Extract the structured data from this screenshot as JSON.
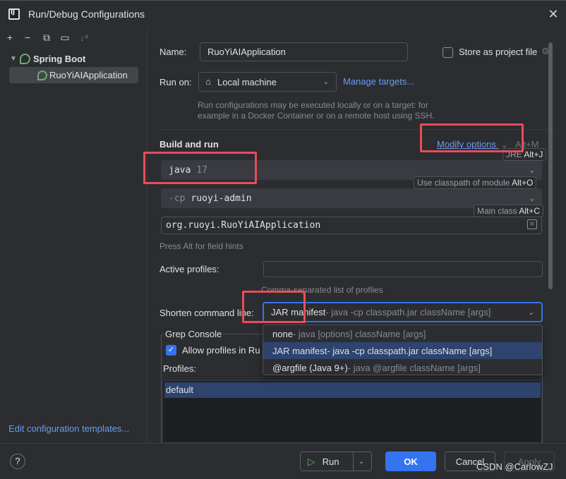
{
  "window": {
    "title": "Run/Debug Configurations"
  },
  "toolbar": {
    "add": "+",
    "remove": "−",
    "copy": "⧉",
    "folder": "▭",
    "sort": "↓ᵃ"
  },
  "tree": {
    "group_label": "Spring Boot",
    "items": [
      {
        "label": "RuoYiAIApplication"
      }
    ]
  },
  "edit_templates_link": "Edit configuration templates...",
  "form": {
    "name_label": "Name:",
    "name_value": "RuoYiAIApplication",
    "store_label": "Store as project file",
    "run_on_label": "Run on:",
    "run_on_value": "Local machine",
    "manage_targets": "Manage targets...",
    "run_on_hint_1": "Run configurations may be executed locally or on a target: for",
    "run_on_hint_2": "example in a Docker Container or on a remote host using SSH.",
    "section_build": "Build and run",
    "modify_options": "Modify options",
    "modify_shortcut": "Alt+M",
    "jre_value": "java",
    "jre_version": "17",
    "cp_prefix": "-cp",
    "cp_value": "ruoyi-admin",
    "main_class": "org.ruoyi.RuoYiAIApplication",
    "field_hint": "Press Alt for field hints",
    "active_profiles_label": "Active profiles:",
    "active_profiles_value": "",
    "active_profiles_hint": "Comma-separated list of profiles",
    "shorten_label": "Shorten command line:",
    "shorten_value": "JAR manifest",
    "shorten_value_detail": " - java -cp classpath.jar className [args]",
    "grep_console": "Grep Console",
    "allow_profiles": "Allow profiles in Ru",
    "profiles_label": "Profiles:",
    "profiles": [
      "default"
    ]
  },
  "tips": {
    "jre": {
      "text": "JRE ",
      "key": "Alt+J"
    },
    "classpath": {
      "text": "Use classpath of module ",
      "key": "Alt+O"
    },
    "main_class": {
      "text": "Main class ",
      "key": "Alt+C"
    }
  },
  "shorten_options": [
    {
      "name": "none",
      "detail": " - java [options] className [args]"
    },
    {
      "name": "JAR manifest",
      "detail": " - java -cp classpath.jar className [args]"
    },
    {
      "name": "@argfile (Java 9+)",
      "detail": " - java @argfile className [args]"
    }
  ],
  "buttons": {
    "help": "?",
    "run": "Run",
    "ok": "OK",
    "cancel": "Cancel",
    "apply": "Apply"
  },
  "watermark": "CSDN @CarlowZJ",
  "colors": {
    "background": "#2b2d30",
    "accent": "#3574f0",
    "link": "#6c9bf0",
    "selection": "#2e436e",
    "highlight_box": "#e84d5a"
  }
}
